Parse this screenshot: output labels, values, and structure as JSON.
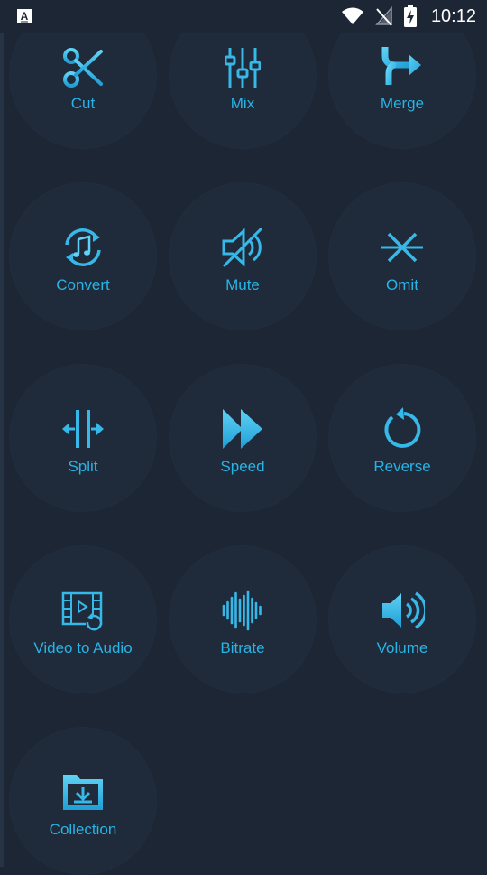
{
  "status_bar": {
    "notification_icon": "a-letter-icon",
    "wifi_icon": "wifi-icon",
    "signal_icon": "no-signal-icon",
    "battery_icon": "battery-charging-icon",
    "time": "10:12"
  },
  "tools": [
    {
      "label": "Cut",
      "icon": "scissors-icon"
    },
    {
      "label": "Mix",
      "icon": "sliders-icon"
    },
    {
      "label": "Merge",
      "icon": "merge-arrow-icon"
    },
    {
      "label": "Convert",
      "icon": "convert-music-icon"
    },
    {
      "label": "Mute",
      "icon": "speaker-mute-icon"
    },
    {
      "label": "Omit",
      "icon": "omit-icon"
    },
    {
      "label": "Split",
      "icon": "split-icon"
    },
    {
      "label": "Speed",
      "icon": "fast-forward-icon"
    },
    {
      "label": "Reverse",
      "icon": "reverse-icon"
    },
    {
      "label": "Video to Audio",
      "icon": "film-convert-icon"
    },
    {
      "label": "Bitrate",
      "icon": "waveform-icon"
    },
    {
      "label": "Volume",
      "icon": "speaker-volume-icon"
    },
    {
      "label": "Collection",
      "icon": "folder-download-icon"
    }
  ],
  "colors": {
    "background": "#1c2634",
    "tile": "#1f2a3a",
    "accent": "#27b4e6",
    "accent_light": "#5fd2f5"
  }
}
